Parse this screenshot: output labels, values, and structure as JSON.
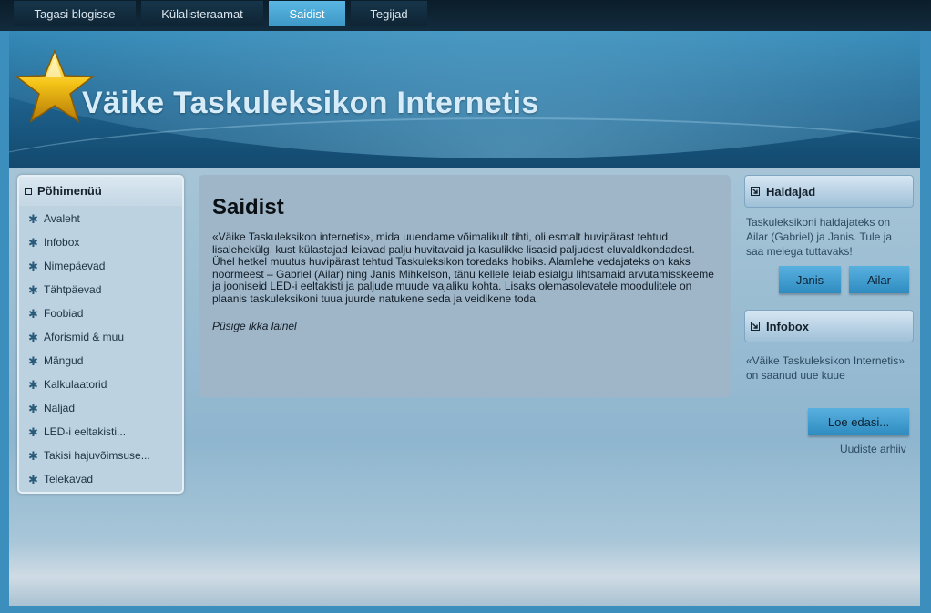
{
  "nav": {
    "tabs": [
      {
        "label": "Tagasi blogisse"
      },
      {
        "label": "Külalisteraamat"
      },
      {
        "label": "Saidist",
        "active": true
      },
      {
        "label": "Tegijad"
      }
    ]
  },
  "header": {
    "title": "Väike Taskuleksikon Internetis",
    "logo_icon": "star-icon"
  },
  "menu": {
    "title": "Põhimenüü",
    "items": [
      {
        "label": "Avaleht"
      },
      {
        "label": "Infobox"
      },
      {
        "label": "Nimepäevad"
      },
      {
        "label": "Tähtpäevad"
      },
      {
        "label": "Foobiad"
      },
      {
        "label": "Aforismid & muu"
      },
      {
        "label": "Mängud"
      },
      {
        "label": "Kalkulaatorid"
      },
      {
        "label": "Naljad"
      },
      {
        "label": "LED-i eeltakisti..."
      },
      {
        "label": "Takisi hajuvõimsuse..."
      },
      {
        "label": "Telekavad"
      }
    ]
  },
  "content": {
    "title": "Saidist",
    "body": "«Väike Taskuleksikon internetis», mida uuendame võimalikult tihti, oli esmalt huvipärast tehtud lisalehekülg, kust külastajad leiavad palju huvitavaid ja kasulikke lisasid paljudest eluvaldkondadest. Ühel hetkel muutus huvipärast tehtud Taskuleksikon toredaks hobiks. Alamlehe vedajateks on kaks noormeest – Gabriel (Ailar) ning Janis Mihkelson, tänu kellele leiab esialgu lihtsamaid arvutamisskeeme ja jooniseid LED-i eeltakisti ja paljude muude vajaliku kohta. Lisaks olemasolevatele moodulitele on plaanis taskuleksikoni tuua juurde natukene seda ja veidikene toda.",
    "signature": "Püsige ikka lainel"
  },
  "admins": {
    "title": "Haldajad",
    "text": "Taskuleksikoni haldajateks on Ailar (Gabriel) ja Janis. Tule ja saa meiega tuttavaks!",
    "buttons": [
      "Janis",
      "Ailar"
    ]
  },
  "infobox": {
    "title": "Infobox",
    "text": "«Väike Taskuleksikon Internetis» on saanud uue kuue",
    "read_more": "Loe edasi...",
    "archive": "Uudiste arhiiv"
  },
  "colors": {
    "accent": "#3d98c7",
    "header_bg": "#1c5f8a",
    "title_text": "#d6ecf8"
  }
}
